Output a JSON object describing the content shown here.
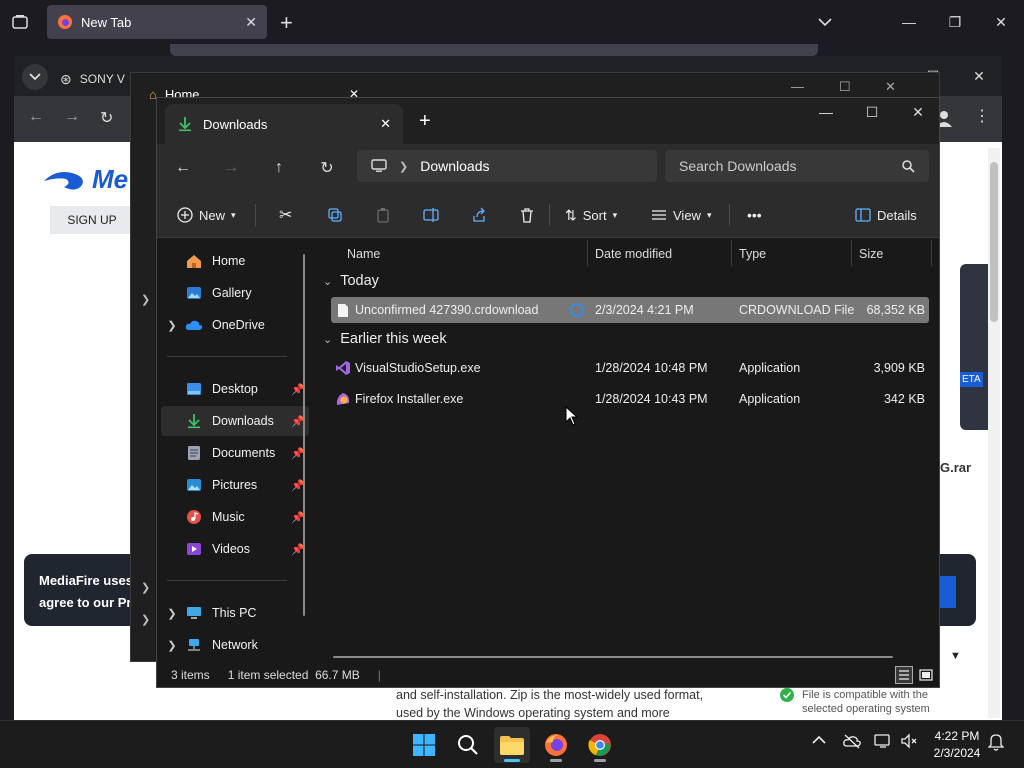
{
  "firefox": {
    "tab_title": "New Tab"
  },
  "chrome": {
    "tab_title": "SONY V",
    "page": {
      "logo": "Me",
      "signup": "SIGN UP",
      "banner_line1": "MediaFire uses",
      "banner_line2": "agree to our Pri",
      "side_text_beta": "ETA",
      "side_text_rar": "G.rar",
      "desc_line1": "and self-installation. Zip is the most-widely used format,",
      "desc_line2": "used by the Windows operating system and more",
      "compat_line1": "File is compatible with the",
      "compat_line2": "selected operating system"
    }
  },
  "explorer_home": {
    "tab_title": "Home"
  },
  "explorer": {
    "tab_title": "Downloads",
    "address_current": "Downloads",
    "search_placeholder": "Search Downloads",
    "commands": {
      "new": "New",
      "sort": "Sort",
      "view": "View",
      "more": "•••",
      "details": "Details"
    },
    "sidebar": [
      {
        "label": "Home",
        "icon": "home-icon"
      },
      {
        "label": "Gallery",
        "icon": "gallery-icon"
      },
      {
        "label": "OneDrive",
        "icon": "onedrive-icon"
      },
      {
        "label": "Desktop",
        "icon": "desktop-icon"
      },
      {
        "label": "Downloads",
        "icon": "downloads-icon"
      },
      {
        "label": "Documents",
        "icon": "documents-icon"
      },
      {
        "label": "Pictures",
        "icon": "pictures-icon"
      },
      {
        "label": "Music",
        "icon": "music-icon"
      },
      {
        "label": "Videos",
        "icon": "videos-icon"
      },
      {
        "label": "This PC",
        "icon": "this-pc-icon"
      },
      {
        "label": "Network",
        "icon": "network-icon"
      }
    ],
    "columns": {
      "name": "Name",
      "date": "Date modified",
      "type": "Type",
      "size": "Size"
    },
    "groups": {
      "today": "Today",
      "earlier": "Earlier this week"
    },
    "files": [
      {
        "name": "Unconfirmed 427390.crdownload",
        "date": "2/3/2024 4:21 PM",
        "type": "CRDOWNLOAD File",
        "size": "68,352 KB"
      },
      {
        "name": "VisualStudioSetup.exe",
        "date": "1/28/2024 10:48 PM",
        "type": "Application",
        "size": "3,909 KB"
      },
      {
        "name": "Firefox Installer.exe",
        "date": "1/28/2024 10:43 PM",
        "type": "Application",
        "size": "342 KB"
      }
    ],
    "status": {
      "items": "3 items",
      "selected": "1 item selected  66.7 MB"
    }
  },
  "taskbar": {
    "time": "4:22 PM",
    "date": "2/3/2024"
  },
  "colors": {
    "accent": "#4cc2ff",
    "folder_yellow": "#f2c14e",
    "selection": "#777777"
  }
}
